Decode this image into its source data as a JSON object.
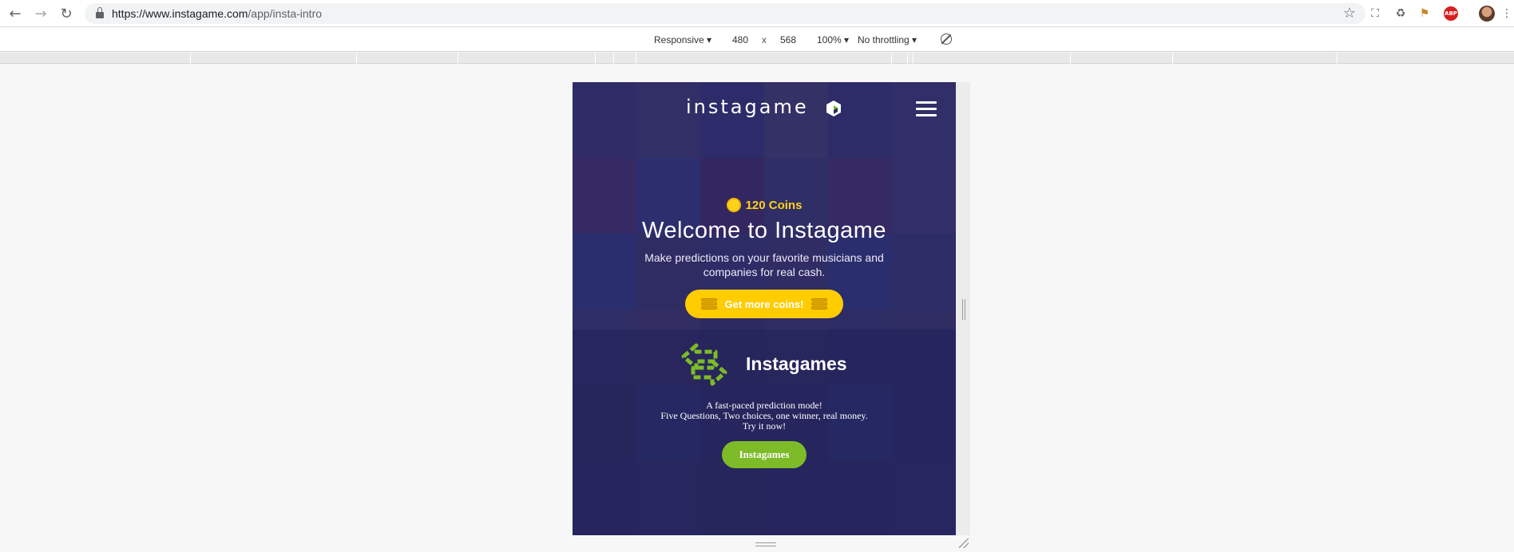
{
  "browser": {
    "url_host": "https://www.instagame.com",
    "url_path": "/app/insta-intro"
  },
  "devtools": {
    "device": "Responsive",
    "width": "480",
    "times": "x",
    "height": "568",
    "zoom": "100%",
    "throttling": "No throttling"
  },
  "app": {
    "logo": "instagame",
    "coins": "120 Coins",
    "welcome": "Welcome to Instagame",
    "subtitle": "Make predictions on your favorite musicians and companies for real cash.",
    "get_coins_button": "Get more coins!",
    "mode_title": "Instagames",
    "mode_line1": "A fast-paced prediction mode!",
    "mode_line2": "Five Questions, Two choices, one winner, real money.",
    "mode_line3": "Try it now!",
    "mode_button": "Instagames"
  },
  "colors": {
    "coin_yellow": "#ffcc00",
    "green": "#7dbb28",
    "overlay": "#2b2a6e"
  }
}
